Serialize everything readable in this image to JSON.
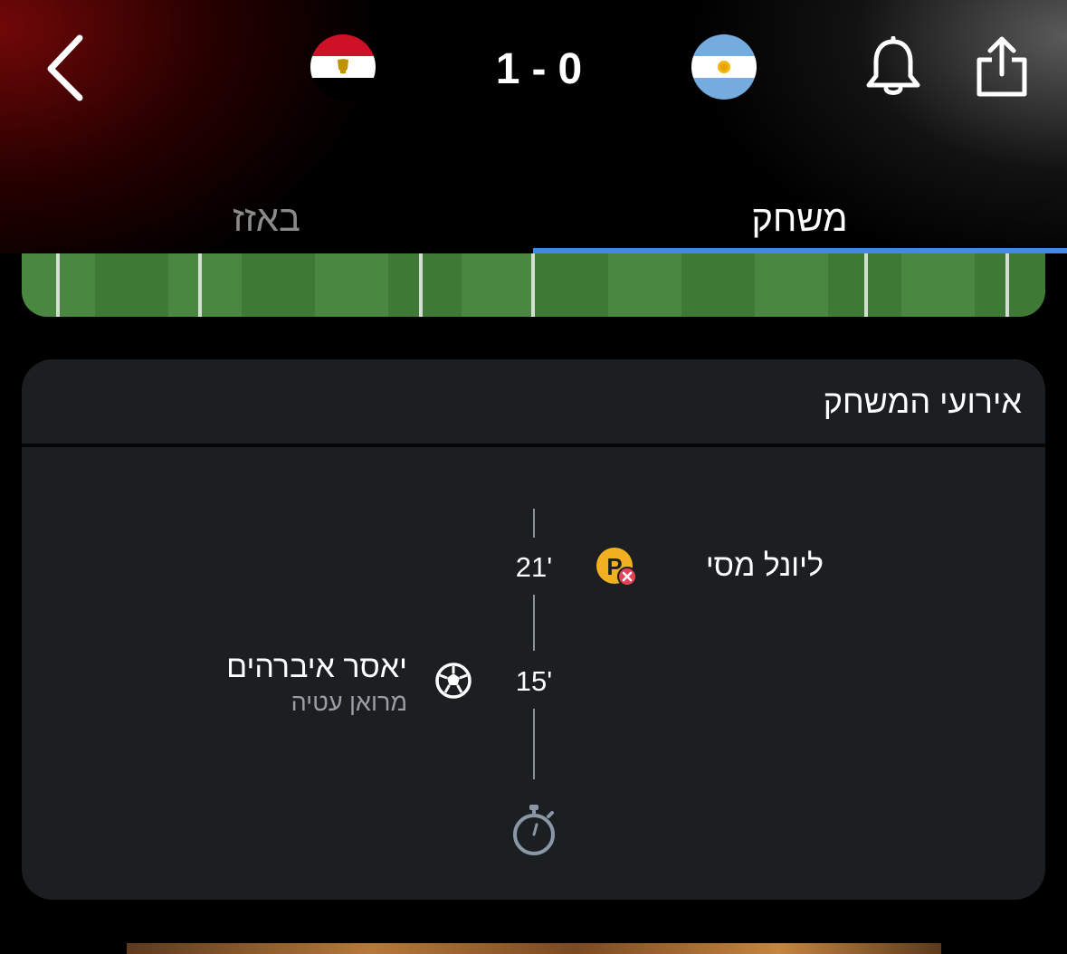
{
  "header": {
    "home_team_flag": "egypt-flag",
    "away_team_flag": "argentina-flag",
    "score": {
      "left": "1",
      "separator": "-",
      "right": "0"
    }
  },
  "tabs": [
    {
      "label": "באזז",
      "active": false
    },
    {
      "label": "משחק",
      "active": true
    }
  ],
  "events_card": {
    "title": "אירועי המשחק",
    "events": [
      {
        "minute": "21'",
        "player": "ליונל מסי",
        "icon": "missed-penalty-icon",
        "side": "argentina"
      },
      {
        "minute": "15'",
        "player": "יאסר איברהים",
        "assist": "מרואן עטיה",
        "icon": "goal-ball-icon",
        "side": "egypt"
      }
    ],
    "footer_icon": "stopwatch-icon"
  },
  "colors": {
    "accent": "#3a8cf0",
    "card_bg": "#1b1f22",
    "penalty_badge": "#f0b020",
    "missed_badge": "#e84355"
  }
}
